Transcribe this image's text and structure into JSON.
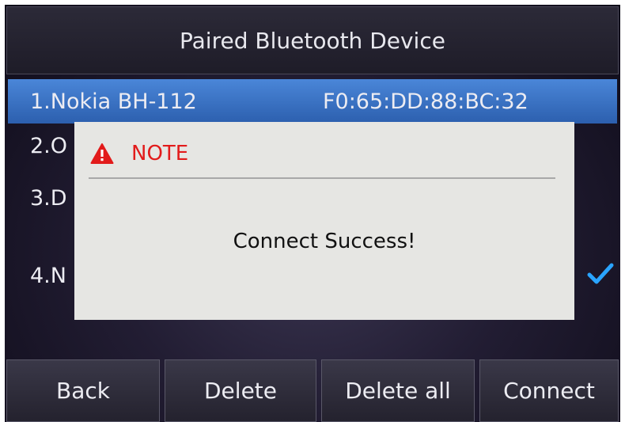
{
  "header": {
    "title": "Paired Bluetooth Device"
  },
  "devices": [
    {
      "label": "1.Nokia BH-112",
      "mac": "F0:65:DD:88:BC:32",
      "selected": true
    },
    {
      "label": "2.O",
      "mac": "",
      "selected": false
    },
    {
      "label": "3.D",
      "mac": "",
      "selected": false
    },
    {
      "label": "4.N",
      "mac": "",
      "selected": false,
      "connected_icon": "checkmark-icon"
    }
  ],
  "softkeys": {
    "back": "Back",
    "delete": "Delete",
    "delete_all": "Delete all",
    "connect": "Connect"
  },
  "dialog": {
    "icon": "warning-icon",
    "title": "NOTE",
    "message": "Connect Success!"
  },
  "colors": {
    "selected_row": "#3a74c8",
    "note_title": "#e21b1b",
    "checkmark": "#2aa4ff"
  }
}
